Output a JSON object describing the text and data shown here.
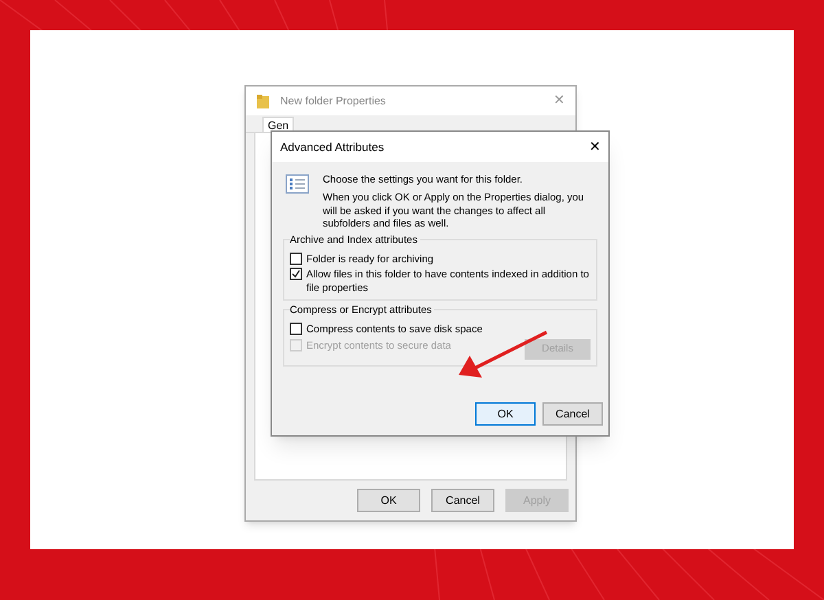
{
  "properties_window": {
    "title": "New folder Properties",
    "tabs": [
      {
        "label": "Gen",
        "selected": true
      }
    ],
    "buttons": [
      {
        "label": "OK",
        "disabled": false
      },
      {
        "label": "Cancel",
        "disabled": false
      },
      {
        "label": "Apply",
        "disabled": true
      }
    ]
  },
  "advanced_dialog": {
    "title": "Advanced Attributes",
    "close": "✕",
    "intro": "Choose the settings you want for this folder.",
    "description": "When you click OK or Apply on the Properties dialog, you will be asked if you want the changes to affect all subfolders and files as well.",
    "groups": [
      {
        "title": "Archive and Index attributes",
        "options": [
          {
            "label": "Folder is ready for archiving",
            "checked": false,
            "disabled": false
          },
          {
            "label": "Allow files in this folder to have contents indexed in addition to file properties",
            "checked": true,
            "disabled": false
          }
        ]
      },
      {
        "title": "Compress or Encrypt attributes",
        "options": [
          {
            "label": "Compress contents to save disk space",
            "checked": false,
            "disabled": false
          },
          {
            "label": "Encrypt contents to secure data",
            "checked": false,
            "disabled": true
          }
        ],
        "button": {
          "label": "Details",
          "disabled": true
        }
      }
    ],
    "buttons": [
      {
        "label": "OK",
        "default": true
      },
      {
        "label": "Cancel",
        "default": false
      }
    ]
  },
  "close": "✕"
}
